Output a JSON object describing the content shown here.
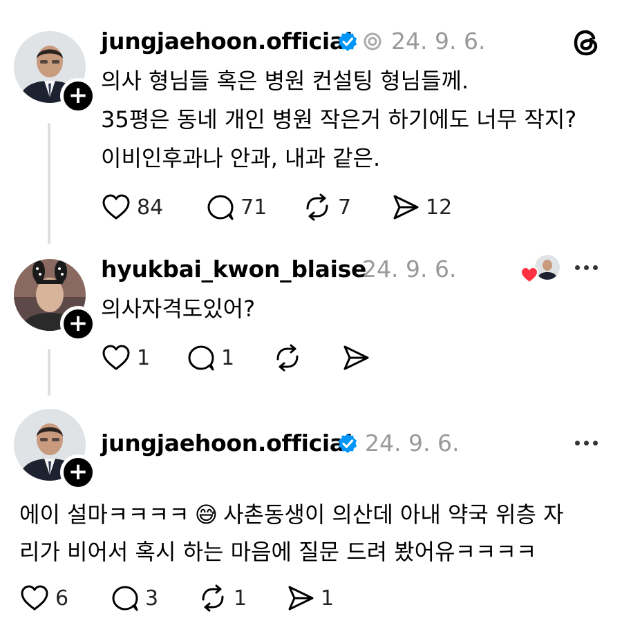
{
  "app": {
    "logo_icon": "threads-logo-icon"
  },
  "posts": [
    {
      "username": "jungjaehoon.official",
      "date": "24. 9. 6.",
      "lines": [
        "의사 형님들 혹은 병원 컨설팅 형님들께.",
        "35평은 동네 개인 병원 작은거 하기에도 너무 작지?",
        "이비인후과나 안과, 내과 같은."
      ],
      "likes": "84",
      "replies": "71",
      "reposts": "7",
      "shares": "12"
    },
    {
      "username": "hyukbai_kwon_blaise",
      "date": "24. 9. 6.",
      "lines": [
        "의사자격도있어?"
      ],
      "likes": "1",
      "replies": "1"
    },
    {
      "username": "jungjaehoon.official",
      "date": "24. 9. 6.",
      "line1_prefix": "에이 설마ㅋㅋㅋㅋ",
      "emoji": "😅",
      "line1_suffix": "사촌동생이 의산데 아내 약국 위층 자",
      "line2": "리가 비어서 혹시 하는 마음에 질문 드려 봤어유ㅋㅋㅋㅋ",
      "likes": "6",
      "replies": "3",
      "reposts": "1",
      "shares": "1"
    }
  ],
  "colors": {
    "verified": "#0095f6",
    "heart": "#ff3040",
    "muted": "#999999"
  }
}
